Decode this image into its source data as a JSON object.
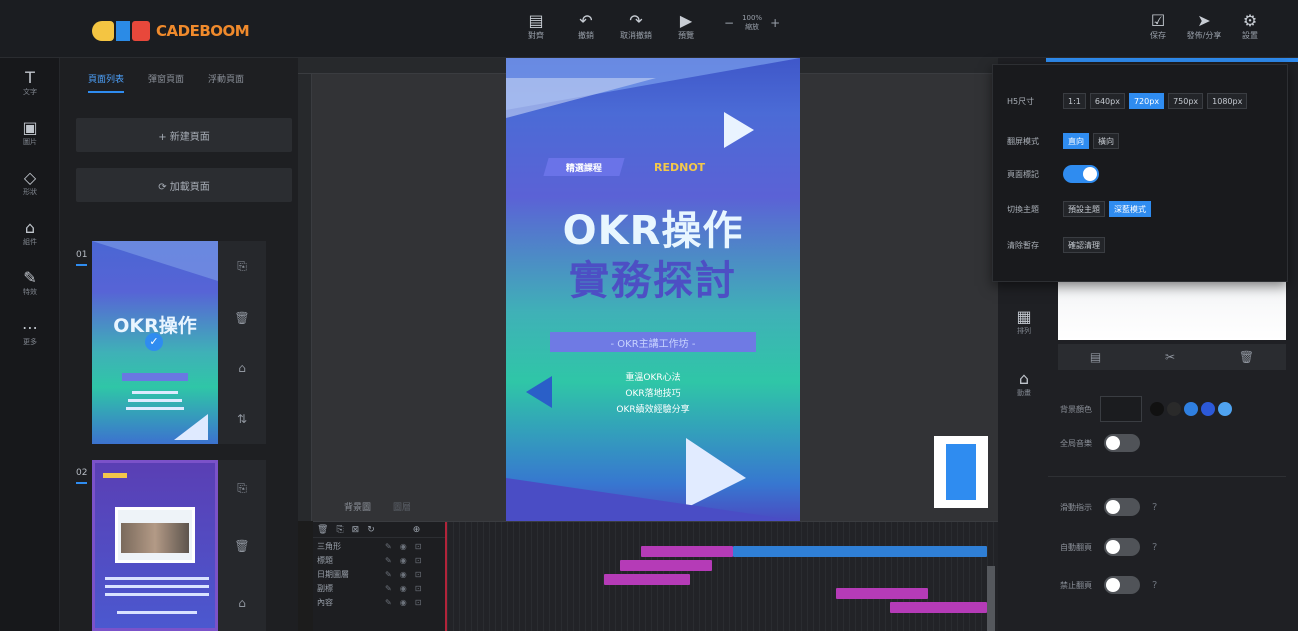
{
  "app": {
    "logo_text": "CADEBOOM"
  },
  "topbar": {
    "tools": [
      {
        "icon": "align-icon",
        "label": "對齊"
      },
      {
        "icon": "undo-icon",
        "label": "撤銷"
      },
      {
        "icon": "redo-icon",
        "label": "取消撤銷"
      },
      {
        "icon": "play-icon",
        "label": "預覽"
      }
    ],
    "zoom_value": "100%",
    "zoom_label": "縮放",
    "right_tools": [
      {
        "icon": "check-icon",
        "label": "保存"
      },
      {
        "icon": "send-icon",
        "label": "發佈/分享"
      },
      {
        "icon": "gear-icon",
        "label": "設置"
      }
    ]
  },
  "rail": {
    "items": [
      {
        "icon": "text-icon",
        "label": "文字"
      },
      {
        "icon": "image-icon",
        "label": "圖片"
      },
      {
        "icon": "shape-icon",
        "label": "形狀"
      },
      {
        "icon": "widget-icon",
        "label": "組件"
      },
      {
        "icon": "pen-icon",
        "label": "特效"
      },
      {
        "icon": "more-icon",
        "label": "更多"
      }
    ]
  },
  "pages": {
    "tabs": [
      "頁面列表",
      "彈窗頁面",
      "浮動頁面"
    ],
    "add_label": "+ 新建頁面",
    "copy_label": "⟳ 加載頁面",
    "items": [
      {
        "num": "01",
        "headline": "OKR操作"
      },
      {
        "num": "02",
        "headline": ""
      }
    ]
  },
  "poster": {
    "tag_left": "精選課程",
    "tag_right": "REDNOT",
    "title_1": "OKR操作",
    "title_2": "實務探討",
    "subtitle": "- OKR主講工作坊 -",
    "bullets": [
      "重溫OKR心法",
      "OKR落地技巧",
      "OKR績效經驗分享"
    ]
  },
  "canvas_tabs": [
    "背景圖",
    "圖層"
  ],
  "timeline": {
    "rows": [
      "三角形",
      "標題",
      "日期圖層",
      "副標",
      "內容"
    ],
    "bars": [
      {
        "row": 0,
        "start": 0.36,
        "end": 0.53,
        "color": "#b53bb7"
      },
      {
        "row": 0,
        "start": 0.53,
        "end": 1.0,
        "color": "#2f7fd6"
      },
      {
        "row": 1,
        "start": 0.32,
        "end": 0.49,
        "color": "#b53bb7"
      },
      {
        "row": 2,
        "start": 0.29,
        "end": 0.45,
        "color": "#b53bb7"
      },
      {
        "row": 3,
        "start": 0.72,
        "end": 0.89,
        "color": "#b53bb7"
      },
      {
        "row": 4,
        "start": 0.82,
        "end": 1.0,
        "color": "#b53bb7"
      }
    ]
  },
  "props": {
    "size_label": "H5尺寸",
    "sizes": [
      "1:1",
      "640px",
      "720px",
      "750px",
      "1080px"
    ],
    "size_active": "720px",
    "orient_label": "翻屏模式",
    "orients": [
      "直向",
      "橫向"
    ],
    "orient_active": "直向",
    "mark_label": "頁面標記",
    "theme_label": "切換主題",
    "themes": [
      "預設主題",
      "深藍模式"
    ],
    "theme_active": "深藍模式",
    "clear_label": "清除暫存",
    "clear_btn": "確認清理"
  },
  "rightpanel": {
    "side_icons": [
      {
        "icon": "grid-icon",
        "label": "排列"
      },
      {
        "icon": "bag-icon",
        "label": "動畫"
      }
    ],
    "bg_color_label": "背景顏色",
    "opt1_label": "全局音樂",
    "opt2_label": "滑動指示",
    "opt3_label": "自動翻頁",
    "opt4_label": "禁止翻頁",
    "swatch_colors": [
      "#111111",
      "#2a2a2a",
      "#2f7fe0",
      "#2c59d8",
      "#4fa3f0"
    ]
  }
}
